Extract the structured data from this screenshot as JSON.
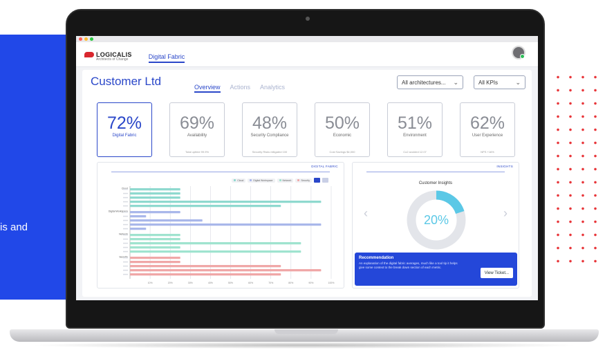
{
  "marketing": {
    "panel_text": "is and"
  },
  "app": {
    "brand": "LOGICALIS",
    "tagline": "Architects of Change",
    "nav_label": "Digital Fabric"
  },
  "page": {
    "title": "Customer Ltd",
    "tabs": [
      {
        "label": "Overview",
        "active": true
      },
      {
        "label": "Actions",
        "active": false
      },
      {
        "label": "Analytics",
        "active": false
      }
    ],
    "filters": {
      "architecture": "All architectures...",
      "kpi": "All KPIs"
    }
  },
  "kpis": [
    {
      "value": "72%",
      "label": "Digital Fabric",
      "footer": "",
      "active": true
    },
    {
      "value": "69%",
      "label": "Availability",
      "footer": "Total uptime 99.9%",
      "active": false
    },
    {
      "value": "48%",
      "label": "Security Compliance",
      "footer": "Security Risks mitigated 100",
      "active": false
    },
    {
      "value": "50%",
      "label": "Economic",
      "footer": "Cost Savings $4,000",
      "active": false
    },
    {
      "value": "51%",
      "label": "Environment",
      "footer": "Co2 avoided 12.07",
      "active": false
    },
    {
      "value": "62%",
      "label": "User Experience",
      "footer": "NPS +16%",
      "active": false
    }
  ],
  "digital_fabric_panel": {
    "title": "DIGITAL FABRIC",
    "legend": [
      {
        "name": "Cloud",
        "color": "#8fd9cf"
      },
      {
        "name": "Digital Workspace",
        "color": "#a9b7ea"
      },
      {
        "name": "Network",
        "color": "#9fe3cf"
      },
      {
        "name": "Security",
        "color": "#f0a7a7"
      }
    ]
  },
  "chart_data": {
    "type": "bar",
    "orientation": "horizontal",
    "groups": [
      "Cloud",
      "Digital Workspace",
      "Network",
      "Security"
    ],
    "series": [
      {
        "name": "Cloud",
        "color": "#8fd9cf",
        "values": [
          25,
          25,
          25,
          95,
          75
        ]
      },
      {
        "name": "Digital Workspace",
        "color": "#a9b7ea",
        "values": [
          25,
          8,
          36,
          95,
          8
        ]
      },
      {
        "name": "Network",
        "color": "#9fe3cf",
        "values": [
          25,
          25,
          85,
          25,
          85
        ]
      },
      {
        "name": "Security",
        "color": "#f0a7a7",
        "values": [
          25,
          25,
          75,
          95,
          75
        ]
      }
    ],
    "x_ticks": [
      "10%",
      "20%",
      "30%",
      "40%",
      "50%",
      "60%",
      "70%",
      "80%",
      "90%",
      "100%"
    ],
    "xlim": [
      0,
      100
    ],
    "grid": true
  },
  "insights_panel": {
    "title": "INSIGHTS",
    "heading": "Customer Insights",
    "donut_value": "20%",
    "donut_fraction": 0.2,
    "donut_color": "#5bc8e6",
    "recommendation": {
      "title": "Recommendation",
      "body": "An explanation of the digital fabric averages, much like a tool tip it helps give some context to the break down section of each metric.",
      "button": "View Ticket..."
    }
  }
}
